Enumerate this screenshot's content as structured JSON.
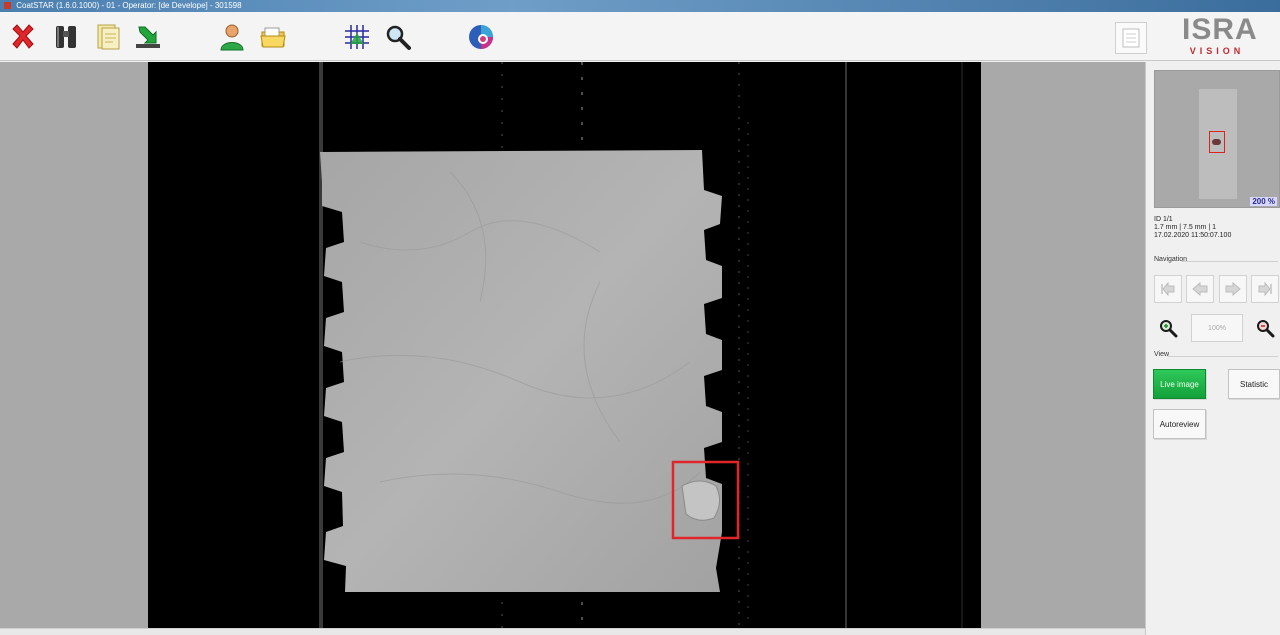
{
  "window": {
    "title": "CoatSTAR (1.6.0.1000) - 01 - Operator: [de Develope] - 301598"
  },
  "toolbar": {
    "buttons": [
      {
        "name": "exit-button",
        "icon": "red-x-icon"
      },
      {
        "name": "binoculars-button",
        "icon": "binoculars-icon"
      },
      {
        "name": "document-button",
        "icon": "document-icon"
      },
      {
        "name": "download-button",
        "icon": "green-arrow-down-icon"
      },
      {
        "name": "user-button",
        "icon": "user-icon"
      },
      {
        "name": "folder-button",
        "icon": "open-folder-icon"
      },
      {
        "name": "grid-button",
        "icon": "grid-icon"
      },
      {
        "name": "search-button",
        "icon": "magnifier-icon"
      },
      {
        "name": "color-button",
        "icon": "color-wheel-icon"
      }
    ],
    "report_icon": "report-icon"
  },
  "logo": {
    "main": "ISRA",
    "sub": "VISION"
  },
  "colors": {
    "accent_green": "#1db446",
    "defect_red": "#e0262b",
    "logo_red": "#c4272e",
    "logo_gray": "#8a8a8a"
  },
  "overview": {
    "zoom": "200 %"
  },
  "defect_info": {
    "line1": "ID 1/1",
    "line2": "1.7 mm | 7.5 mm | 1",
    "line3": "17.02.2020 11:50:07.100"
  },
  "navigation": {
    "label": "Navigation",
    "buttons": [
      "first-icon",
      "previous-icon",
      "next-icon",
      "last-icon"
    ],
    "zoom_in_icon": "zoom-in-icon",
    "zoom_out_icon": "zoom-out-icon",
    "zoom_value": "100%"
  },
  "view": {
    "label": "View",
    "live_image": "Live image",
    "statistic": "Statistic",
    "autoreview": "Autoreview"
  }
}
